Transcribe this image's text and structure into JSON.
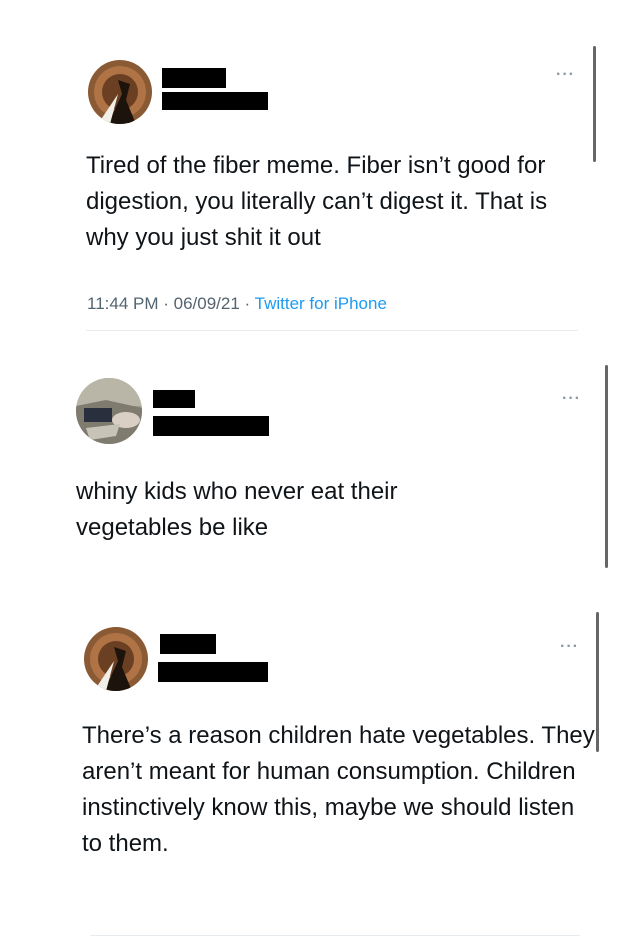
{
  "tweets": [
    {
      "text": "Tired of the fiber meme. Fiber isn’t good for digestion, you literally can’t digest it. That is why you just shit it out",
      "time": "11:44 PM",
      "date": "06/09/21",
      "source": "Twitter for iPhone",
      "separator": " · ",
      "more_icon": "more-horizontal-icon"
    },
    {
      "text": "whiny kids who never eat their vegetables be like",
      "more_icon": "more-horizontal-icon"
    },
    {
      "text": "There’s a reason children hate vegetables. They aren’t meant for human consumption. Children instinctively know this, maybe we should listen to them.",
      "more_icon": "more-horizontal-icon"
    }
  ],
  "more_glyph": "···",
  "colors": {
    "text": "#0f1419",
    "meta": "#536471",
    "link": "#1d9bf0",
    "redaction": "#000000"
  }
}
